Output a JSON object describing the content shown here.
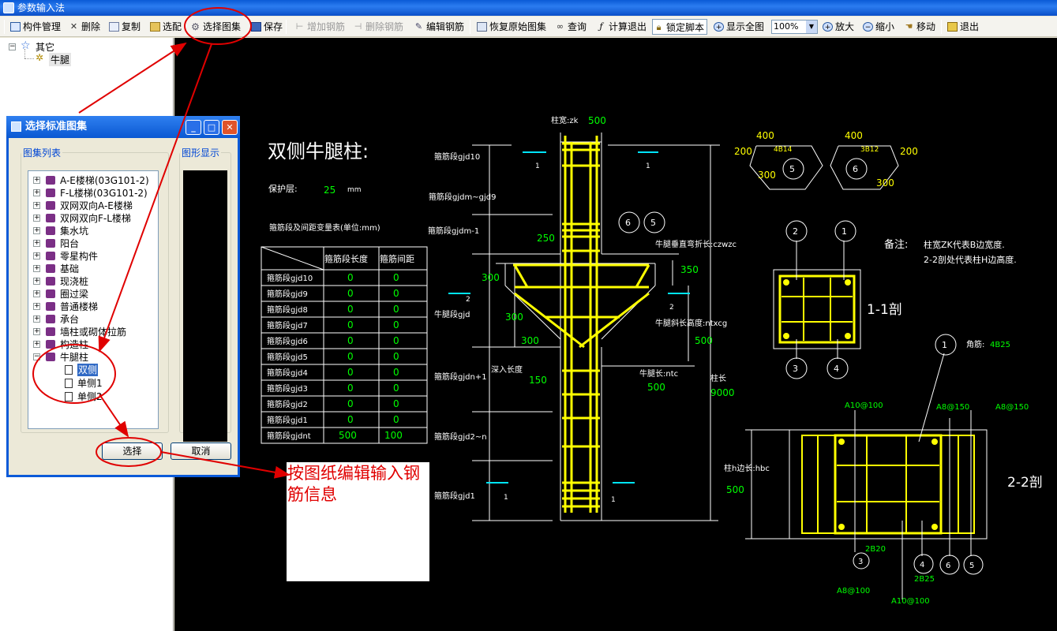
{
  "window": {
    "title": "参数输入法"
  },
  "toolbar": {
    "items": [
      {
        "label": "构件管理"
      },
      {
        "label": "删除"
      },
      {
        "label": "复制"
      },
      {
        "label": "选配"
      },
      {
        "label": "选择图集"
      },
      {
        "label": "保存"
      },
      {
        "label": "增加钢筋"
      },
      {
        "label": "删除钢筋"
      },
      {
        "label": "编辑钢筋"
      },
      {
        "label": "恢复原始图集"
      },
      {
        "label": "查询"
      },
      {
        "label": "计算退出"
      },
      {
        "label": "锁定脚本"
      },
      {
        "label": "显示全图"
      },
      {
        "label": "放大"
      },
      {
        "label": "缩小"
      },
      {
        "label": "移动"
      },
      {
        "label": "退出"
      }
    ],
    "zoom": "100%"
  },
  "tree": {
    "root": "其它",
    "child": "牛腿"
  },
  "dialog": {
    "title": "选择标准图集",
    "list_title": "图集列表",
    "preview_title": "图形显示",
    "items": [
      "A-E楼梯(03G101-2)",
      "F-L楼梯(03G101-2)",
      "双网双向A-E楼梯",
      "双网双向F-L楼梯",
      "集水坑",
      "阳台",
      "零星构件",
      "基础",
      "现浇桩",
      "圈过梁",
      "普通楼梯",
      "承台",
      "墙柱或砌体拉筋",
      "构造柱",
      "牛腿柱"
    ],
    "subitems": [
      "双侧",
      "单侧1",
      "单侧2"
    ],
    "ok": "选择",
    "cancel": "取消"
  },
  "callout": {
    "text": "按图纸编辑输入钢筋信息"
  },
  "drawing": {
    "title": "双侧牛腿柱:",
    "cover_label": "保护层:",
    "cover_value": "25",
    "cover_unit": "mm",
    "table_caption": "箍筋段及间距变量表(单位:mm)",
    "table_headers": [
      "箍筋段长度",
      "箍筋间距"
    ],
    "table_rows": [
      [
        "箍筋段gjd10",
        "0",
        "0"
      ],
      [
        "箍筋段gjd9",
        "0",
        "0"
      ],
      [
        "箍筋段gjd8",
        "0",
        "0"
      ],
      [
        "箍筋段gjd7",
        "0",
        "0"
      ],
      [
        "箍筋段gjd6",
        "0",
        "0"
      ],
      [
        "箍筋段gjd5",
        "0",
        "0"
      ],
      [
        "箍筋段gjd4",
        "0",
        "0"
      ],
      [
        "箍筋段gjd3",
        "0",
        "0"
      ],
      [
        "箍筋段gjd2",
        "0",
        "0"
      ],
      [
        "箍筋段gjd1",
        "0",
        "0"
      ],
      [
        "箍筋段gjdnt",
        "500",
        "100"
      ]
    ],
    "labels": {
      "col_width": "柱宽:zk",
      "col_width_v": "500",
      "gjd10": "箍筋段gjd10",
      "gjdm9": "箍筋段gjdm~gjd9",
      "gjdm1": "箍筋段gjdm-1",
      "gjd": "牛腿段gjd",
      "gjdn1": "箍筋段gjdn+1",
      "gjd2n": "箍筋段gjd2~n",
      "gjd1": "箍筋段gjd1",
      "d250": "250",
      "d300a": "300",
      "d300b": "300",
      "d300c": "300",
      "d350": "350",
      "d500": "500",
      "d150": "150",
      "depth": "深入长度",
      "bend": "牛腿垂直弯折长:czwzc",
      "slope": "牛腿斜长高度:ntxcg",
      "ntc": "牛腿长:ntc",
      "ntc_v": "500",
      "col_len": "柱长",
      "col_len_v": "9000",
      "s400a": "400",
      "s200a": "200",
      "s300a": "300",
      "r4b14": "4B14",
      "s400b": "400",
      "s200b": "200",
      "s300b": "300",
      "r3b12": "3B12",
      "note_title": "备注:",
      "note1": "柱宽ZK代表B边宽度.",
      "note2": "2-2剖处代表柱H边高度.",
      "sec11": "1-1剖",
      "sec22": "2-2剖",
      "corner": "角筋:",
      "corner_v": "4B25",
      "a10a": "A10@100",
      "a8a": "A8@150",
      "a8b": "A8@150",
      "hbc": "柱h边长:hbc",
      "hbc_v": "500",
      "b2b20": "2B20",
      "b2b25": "2B25",
      "a8c": "A8@100",
      "a10b": "A10@100",
      "one": "1",
      "two": "2"
    }
  },
  "colors": {
    "accent": "#ffff00",
    "annotation": "#ff0000",
    "dim_value": "#00ff00",
    "cyan": "#00e5ff"
  }
}
